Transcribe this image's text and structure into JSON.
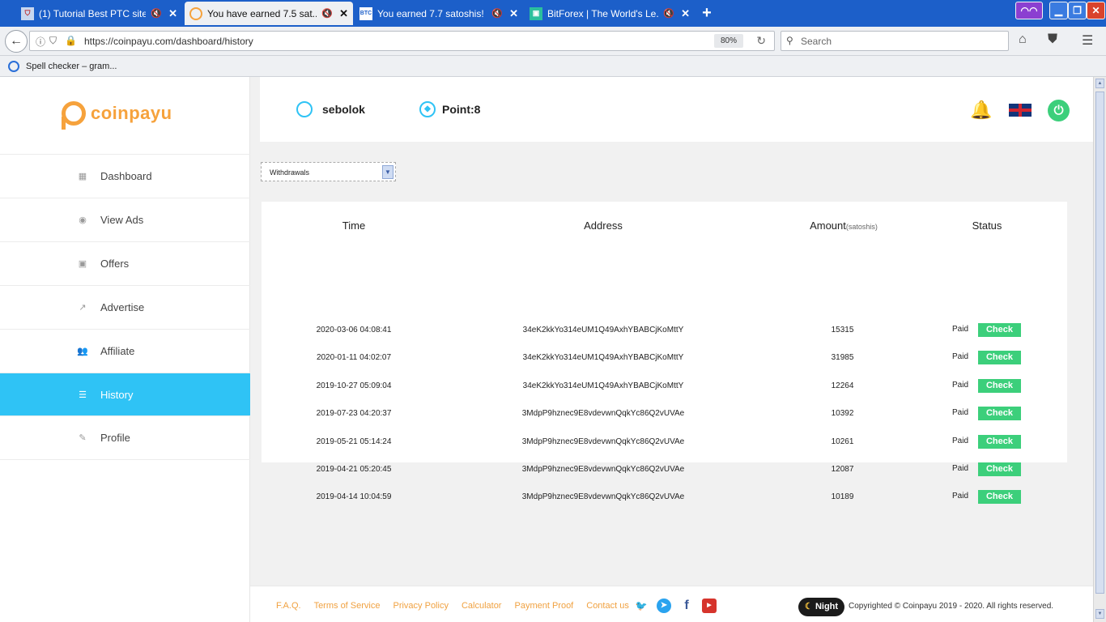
{
  "browser": {
    "tabs": [
      {
        "title": "(1) Tutorial Best PTC site ...",
        "favicon": "shield-tab-favicon",
        "active": false
      },
      {
        "title": "You have earned 7.5 sat...",
        "favicon": "coinpayu-favicon",
        "active": true
      },
      {
        "title": "You earned 7.7 satoshis!",
        "favicon": "btc-favicon",
        "favicon_text": "BTC",
        "active": false
      },
      {
        "title": "BitForex | The World's Le...",
        "favicon": "bitforex-favicon",
        "active": false
      }
    ],
    "url": "https://coinpayu.com/dashboard/history",
    "zoom": "80%",
    "search_placeholder": "Search",
    "bookmark": "Spell checker – gram..."
  },
  "sidebar": {
    "logo_text": "coinpayu",
    "items": [
      {
        "label": "Dashboard",
        "icon": "grid-icon"
      },
      {
        "label": "View Ads",
        "icon": "eye-icon"
      },
      {
        "label": "Offers",
        "icon": "calendar-check-icon"
      },
      {
        "label": "Advertise",
        "icon": "line-chart-icon"
      },
      {
        "label": "Affiliate",
        "icon": "users-icon"
      },
      {
        "label": "History",
        "icon": "menu-icon",
        "active": true
      },
      {
        "label": "Profile",
        "icon": "edit-icon"
      }
    ]
  },
  "header": {
    "username": "sebolok",
    "points": "Point:8"
  },
  "filter": {
    "selected": "Withdrawals"
  },
  "table": {
    "headers": {
      "time": "Time",
      "address": "Address",
      "amount": "Amount",
      "amount_unit": "(satoshis)",
      "status": "Status"
    },
    "rows": [
      {
        "time": "2020-03-06 04:08:41",
        "address": "34eK2kkYo314eUM1Q49AxhYBABCjKoMttY",
        "amount": "15315",
        "status": "Paid",
        "action": "Check"
      },
      {
        "time": "2020-01-11 04:02:07",
        "address": "34eK2kkYo314eUM1Q49AxhYBABCjKoMttY",
        "amount": "31985",
        "status": "Paid",
        "action": "Check"
      },
      {
        "time": "2019-10-27 05:09:04",
        "address": "34eK2kkYo314eUM1Q49AxhYBABCjKoMttY",
        "amount": "12264",
        "status": "Paid",
        "action": "Check"
      },
      {
        "time": "2019-07-23 04:20:37",
        "address": "3MdpP9hznec9E8vdevwnQqkYc86Q2vUVAe",
        "amount": "10392",
        "status": "Paid",
        "action": "Check"
      },
      {
        "time": "2019-05-21 05:14:24",
        "address": "3MdpP9hznec9E8vdevwnQqkYc86Q2vUVAe",
        "amount": "10261",
        "status": "Paid",
        "action": "Check"
      },
      {
        "time": "2019-04-21 05:20:45",
        "address": "3MdpP9hznec9E8vdevwnQqkYc86Q2vUVAe",
        "amount": "12087",
        "status": "Paid",
        "action": "Check"
      },
      {
        "time": "2019-04-14 10:04:59",
        "address": "3MdpP9hznec9E8vdevwnQqkYc86Q2vUVAe",
        "amount": "10189",
        "status": "Paid",
        "action": "Check"
      }
    ]
  },
  "footer": {
    "links": [
      "F.A.Q.",
      "Terms of Service",
      "Privacy Policy",
      "Calculator",
      "Payment Proof",
      "Contact us"
    ],
    "night_label": "Night",
    "copyright": "Copyrighted © Coinpayu 2019 - 2020. All rights reserved."
  },
  "colors": {
    "accent": "#2fc3f5",
    "brand": "#f6a23c",
    "success": "#3ccf7b",
    "tabbar": "#1c5fc9"
  }
}
